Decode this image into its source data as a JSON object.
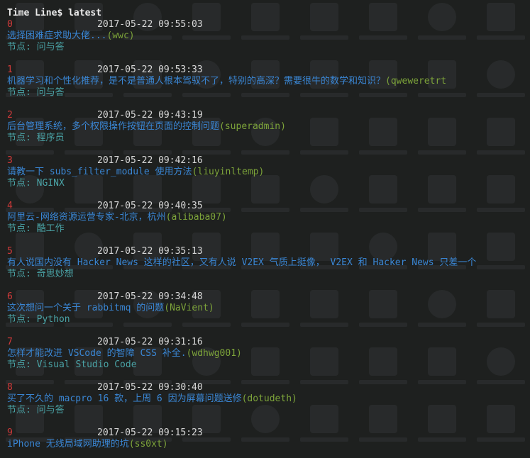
{
  "prompt": "Time Line$ latest",
  "node_prefix": "节点: ",
  "entries": [
    {
      "index": "0",
      "time": "2017-05-22 09:55:03",
      "title": "选择困难症求助大佬...",
      "author": "(wwc)",
      "node": "问与答"
    },
    {
      "index": "1",
      "time": "2017-05-22 09:53:33",
      "title": "机器学习和个性化推荐，是不是普通人根本驾驭不了，特别的高深？需要很牛的数学和知识？",
      "author": "(qweweretrt",
      "node": "问与答"
    },
    {
      "index": "2",
      "time": "2017-05-22 09:43:19",
      "title": "后台管理系统，多个权限操作按钮在页面的控制问题",
      "author": "(superadmin)",
      "node": "程序员"
    },
    {
      "index": "3",
      "time": "2017-05-22 09:42:16",
      "title": "请教一下 subs_filter_module 使用方法",
      "author": "(liuyinltemp)",
      "node": "NGINX"
    },
    {
      "index": "4",
      "time": "2017-05-22 09:40:35",
      "title": "阿里云-网络资源运营专家-北京，杭州",
      "author": "(alibaba07)",
      "node": "酷工作"
    },
    {
      "index": "5",
      "time": "2017-05-22 09:35:13",
      "title": "有人说国内没有 Hacker News 这样的社区，又有人说 V2EX 气质上挺像， V2EX 和 Hacker News 只差一个",
      "author": "",
      "node": "奇思妙想"
    },
    {
      "index": "6",
      "time": "2017-05-22 09:34:48",
      "title": "这次想问一个关于 rabbitmq 的问题",
      "author": "(NaVient)",
      "node": "Python"
    },
    {
      "index": "7",
      "time": "2017-05-22 09:31:16",
      "title": "怎样才能改进 VSCode 的智障 CSS 补全.",
      "author": "(wdhwg001)",
      "node": "Visual Studio Code"
    },
    {
      "index": "8",
      "time": "2017-05-22 09:30:40",
      "title": "买了不久的 macpro 16 款，上周 6 因为屏幕问题送修",
      "author": "(dotudeth)",
      "node": "问与答"
    },
    {
      "index": "9",
      "time": "2017-05-22 09:15:23",
      "title": "iPhone 无线局域网助理的坑",
      "author": "(ss0xt)",
      "node": ""
    }
  ],
  "colors": {
    "background": "#1e201f",
    "prompt": "#ececec",
    "index": "#d13a3a",
    "time": "#d9d9d9",
    "title": "#3a86d4",
    "author": "#7da43a",
    "node": "#4aa3a6"
  }
}
